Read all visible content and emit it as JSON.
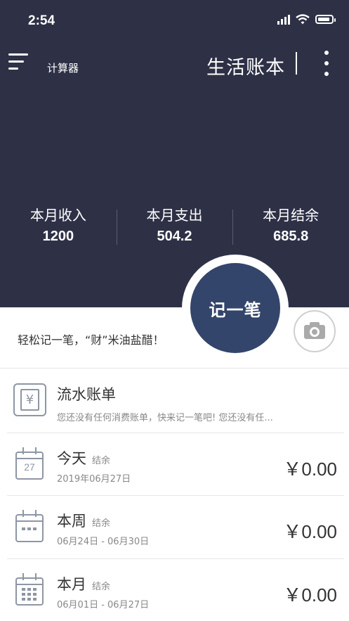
{
  "status_bar": {
    "time": "2:54"
  },
  "header": {
    "calculator_label": "计算器",
    "app_title": "生活账本",
    "stats": [
      {
        "label": "本月收入",
        "value": "1200"
      },
      {
        "label": "本月支出",
        "value": "504.2"
      },
      {
        "label": "本月结余",
        "value": "685.8"
      }
    ]
  },
  "record_button": {
    "label": "记一笔"
  },
  "slogan": "轻松记一笔，“财”米油盐醋！",
  "ledger": {
    "title": "流水账单",
    "subtitle": "您还没有任何消费账单，快来记一笔吧! 您还没有任...",
    "icon_glyph": "¥"
  },
  "summary_rows": [
    {
      "title": "今天",
      "tag": "结余",
      "date": "2019年06月27日",
      "amount": "￥0.00",
      "calendar_day": "27"
    },
    {
      "title": "本周",
      "tag": "结余",
      "date": "06月24日 - 06月30日",
      "amount": "￥0.00"
    },
    {
      "title": "本月",
      "tag": "结余",
      "date": "06月01日 - 06月27日",
      "amount": "￥0.00"
    }
  ],
  "colors": {
    "header_bg": "#2e3146",
    "record_button_bg": "#34456b",
    "icon_gray": "#8e96a4"
  },
  "icons": [
    "menu-icon",
    "more-icon",
    "camera-icon",
    "ledger-icon",
    "calendar-day-icon",
    "calendar-week-icon",
    "calendar-month-icon"
  ]
}
